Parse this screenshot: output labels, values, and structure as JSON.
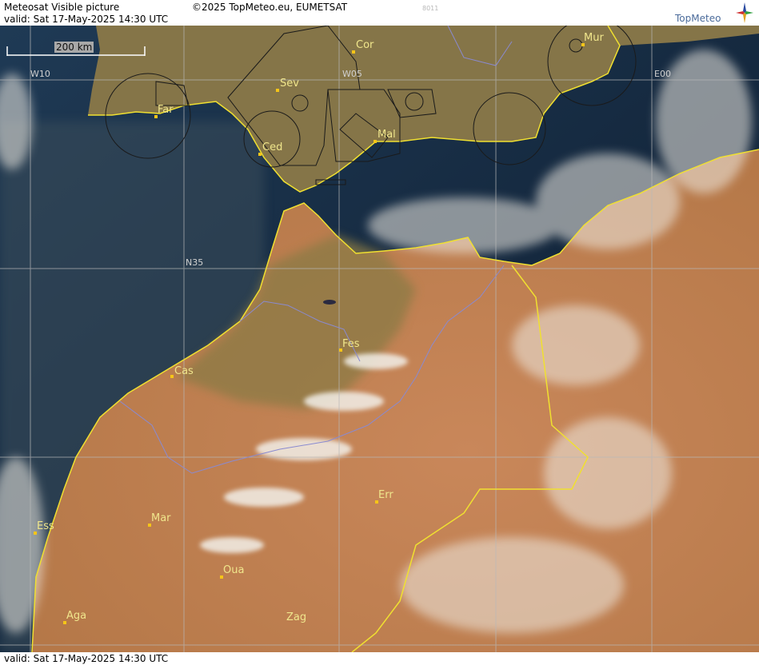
{
  "header": {
    "map_title": "Meteosat Visible picture",
    "copyright": "©2025 TopMeteo.eu, EUMETSAT",
    "valid_text": "valid:  Sat  17-May-2025  14:30 UTC",
    "code": "8011",
    "logo_text": "TopMeteo",
    "logo_icon": "compass-star-icon"
  },
  "footer": {
    "valid_text": "valid:  Sat  17-May-2025  14:30 UTC"
  },
  "scale": {
    "label": "200 km"
  },
  "grid_labels": {
    "w10": "W10",
    "w05": "W05",
    "e00": "E00",
    "n35": "N35"
  },
  "cities": {
    "cor": "Cor",
    "mur": "Mur",
    "sev": "Sev",
    "far": "Far",
    "ced": "Ced",
    "mal": "Mal",
    "fes": "Fes",
    "cas": "Cas",
    "err": "Err",
    "mar": "Mar",
    "ess": "Ess",
    "oua": "Oua",
    "aga": "Aga",
    "zag": "Zag"
  },
  "colors": {
    "sea": "#0f1f35",
    "land_iberia": "#8a7a4a",
    "land_desert": "#c08050",
    "coastline": "#f0e030",
    "border": "#9090d0",
    "city": "#f0e68c",
    "grid": "#b0b0b0"
  }
}
